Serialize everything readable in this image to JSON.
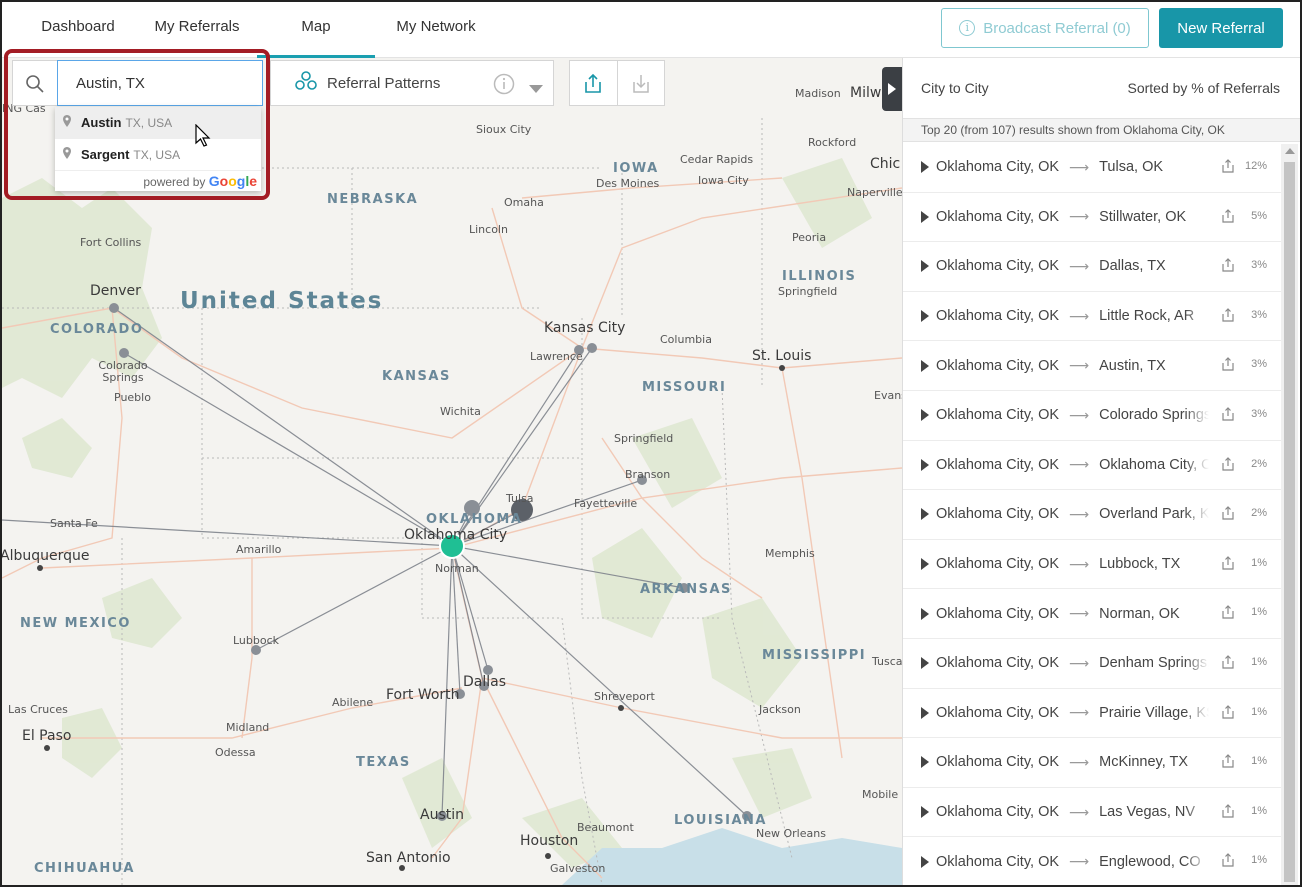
{
  "nav": {
    "tabs": [
      {
        "label": "Dashboard"
      },
      {
        "label": "My Referrals"
      },
      {
        "label": "Map"
      },
      {
        "label": "My Network"
      }
    ],
    "broadcast_label": "Broadcast Referral (0)",
    "new_referral_label": "New Referral",
    "accent": "#1896a8"
  },
  "search": {
    "value": "Austin, TX",
    "suggestions": [
      {
        "name": "Austin",
        "region": "TX, USA"
      },
      {
        "name": "Sargent",
        "region": "TX, USA"
      }
    ],
    "powered_by": "powered by",
    "powered_brand": "Google"
  },
  "controls": {
    "patterns_label": "Referral Patterns"
  },
  "map": {
    "country_label": "United States",
    "states": [
      {
        "name": "NEBRASKA"
      },
      {
        "name": "IOWA"
      },
      {
        "name": "ILLINOIS"
      },
      {
        "name": "COLORADO"
      },
      {
        "name": "KANSAS"
      },
      {
        "name": "MISSOURI"
      },
      {
        "name": "OKLAHOMA"
      },
      {
        "name": "ARKANSAS"
      },
      {
        "name": "NEW MEXICO"
      },
      {
        "name": "MISSISSIPPI"
      },
      {
        "name": "TEXAS"
      },
      {
        "name": "LOUISIANA"
      },
      {
        "name": "CHIHUAHUA"
      }
    ],
    "cities": [
      "Sioux City",
      "Madison",
      "Milw",
      "Cedar Rapids",
      "Des Moines",
      "Iowa City",
      "Omaha",
      "Lincoln",
      "Rockford",
      "Chic",
      "Naperville",
      "Peoria",
      "Springfield",
      "Fort Collins",
      "Denver",
      "Colorado Springs",
      "Pueblo",
      "Kansas City",
      "Lawrence",
      "Columbia",
      "St. Louis",
      "Evans",
      "Wichita",
      "Springfield",
      "Branson",
      "Tulsa",
      "Fayetteville",
      "Oklahoma City",
      "Norman",
      "Santa Fe",
      "Albuquerque",
      "Amarillo",
      "Memphis",
      "Lubbock",
      "Dallas",
      "Fort Worth",
      "Abilene",
      "Shreveport",
      "Tusca",
      "Las Cruces",
      "El Paso",
      "Midland",
      "Odessa",
      "Jackson",
      "Mobile",
      "Austin",
      "Beaumont",
      "New Orleans",
      "Houston",
      "San Antonio",
      "Galveston",
      "ING Cas"
    ]
  },
  "panel": {
    "col_left": "City to City",
    "col_right": "Sorted by % of Referrals",
    "subtitle": "Top 20 (from 107) results shown from Oklahoma City, OK",
    "rows": [
      {
        "from": "Oklahoma City, OK",
        "to": "Tulsa, OK",
        "pct": "12%"
      },
      {
        "from": "Oklahoma City, OK",
        "to": "Stillwater, OK",
        "pct": "5%"
      },
      {
        "from": "Oklahoma City, OK",
        "to": "Dallas, TX",
        "pct": "3%"
      },
      {
        "from": "Oklahoma City, OK",
        "to": "Little Rock, AR",
        "pct": "3%"
      },
      {
        "from": "Oklahoma City, OK",
        "to": "Austin, TX",
        "pct": "3%"
      },
      {
        "from": "Oklahoma City, OK",
        "to": "Colorado Springs, CO",
        "pct": "3%"
      },
      {
        "from": "Oklahoma City, OK",
        "to": "Oklahoma City, OK",
        "pct": "2%"
      },
      {
        "from": "Oklahoma City, OK",
        "to": "Overland Park, KS",
        "pct": "2%"
      },
      {
        "from": "Oklahoma City, OK",
        "to": "Lubbock, TX",
        "pct": "1%"
      },
      {
        "from": "Oklahoma City, OK",
        "to": "Norman, OK",
        "pct": "1%"
      },
      {
        "from": "Oklahoma City, OK",
        "to": "Denham Springs, LA",
        "pct": "1%"
      },
      {
        "from": "Oklahoma City, OK",
        "to": "Prairie Village, KS",
        "pct": "1%"
      },
      {
        "from": "Oklahoma City, OK",
        "to": "McKinney, TX",
        "pct": "1%"
      },
      {
        "from": "Oklahoma City, OK",
        "to": "Las Vegas, NV",
        "pct": "1%"
      },
      {
        "from": "Oklahoma City, OK",
        "to": "Englewood, CO",
        "pct": "1%"
      }
    ]
  }
}
